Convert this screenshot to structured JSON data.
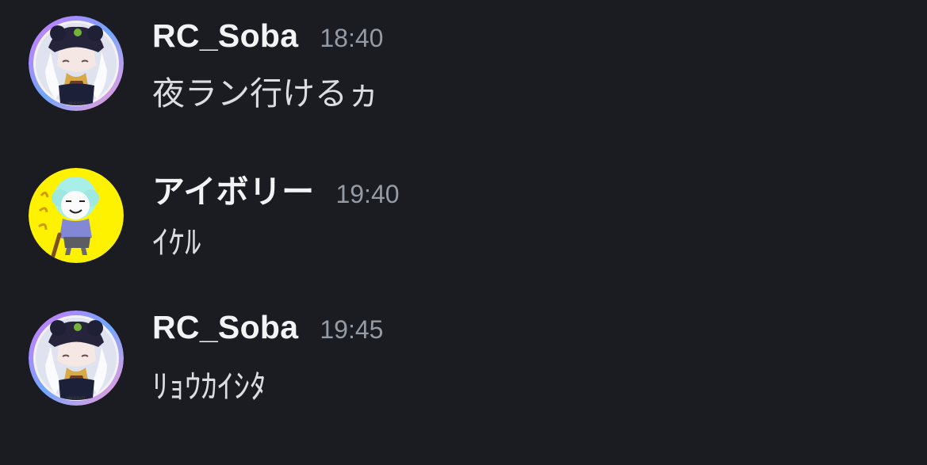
{
  "messages": [
    {
      "username": "RC_Soba",
      "timestamp": "18:40",
      "text": "夜ラン行けるヵ",
      "avatar": "soba-avatar-icon"
    },
    {
      "username": "アイボリー",
      "timestamp": "19:40",
      "text": "ｲｹﾙ",
      "avatar": "ivory-avatar-icon"
    },
    {
      "username": "RC_Soba",
      "timestamp": "19:45",
      "text": "ﾘｮｳｶｲｼﾀ",
      "avatar": "soba-avatar-icon"
    }
  ],
  "colors": {
    "background": "#1b1c21",
    "username": "#f2f3f5",
    "timestamp": "#949ba4",
    "message_text": "#dbdee1",
    "ivory_avatar_bg": "#fff200"
  }
}
